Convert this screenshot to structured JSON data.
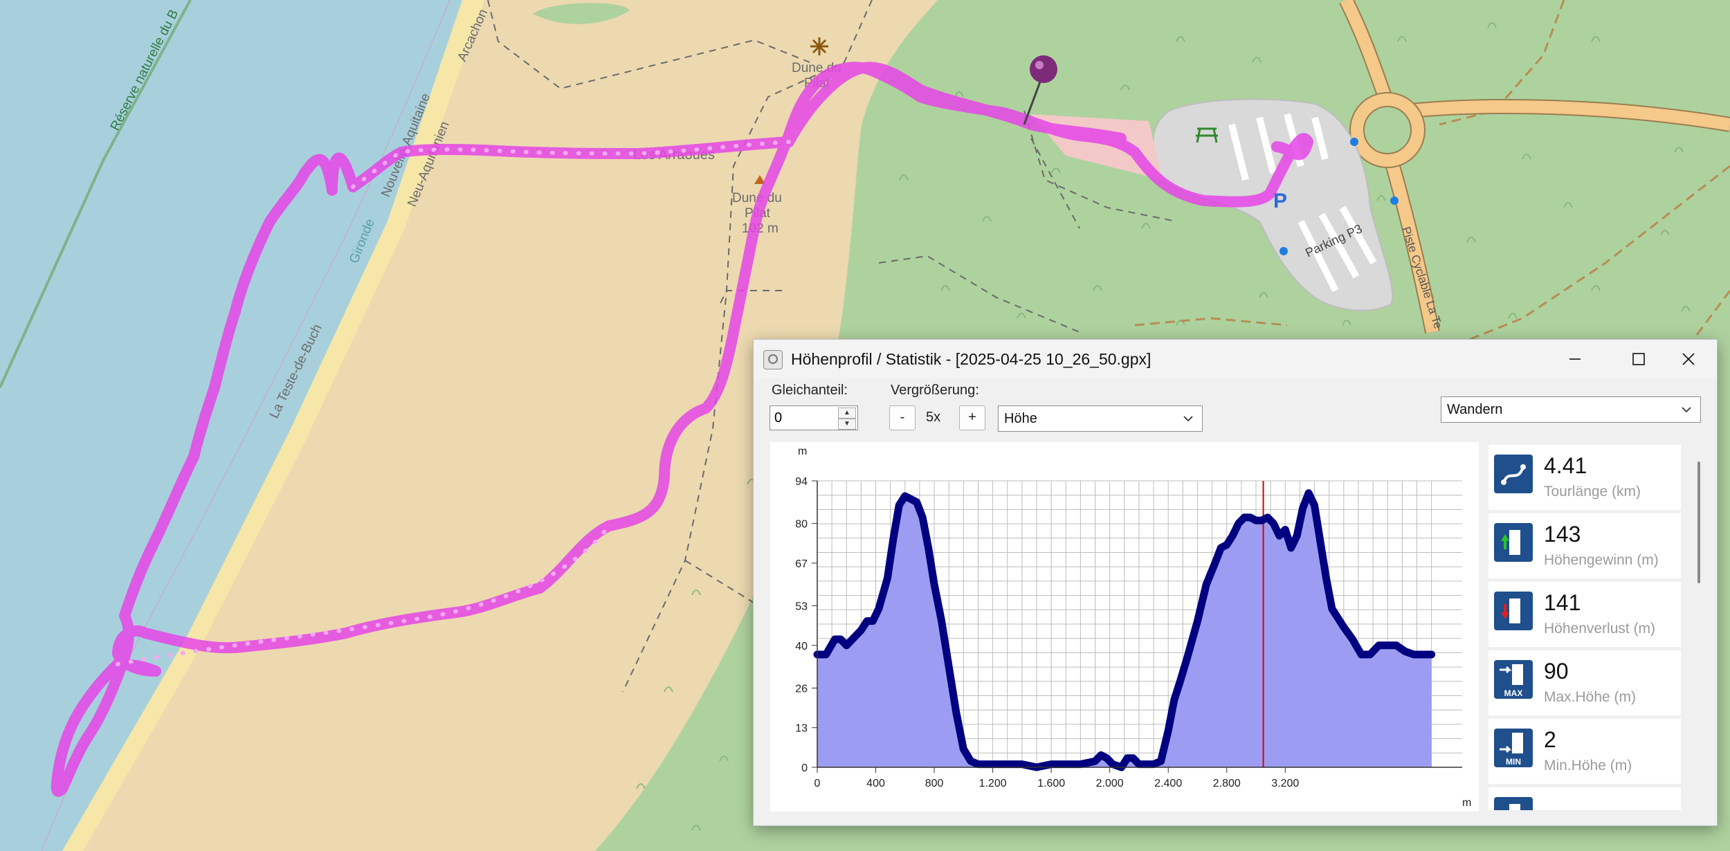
{
  "map": {
    "labels": {
      "reserve": "Réserve naturelle du B",
      "arcachon": "Arcachon",
      "nouvelle_aquitaine": "Nouvelle-Aquitaine",
      "neu_aquitanien": "Neu-Aquitanien",
      "gironde": "Gironde",
      "la_teste": "La Teste-de-Buch",
      "les_arraoues": "Les Arraoues",
      "dune_pilat_1": "Dune du",
      "dune_pilat_1b": "Pilat",
      "dune_pilat_2": "Dune du",
      "dune_pilat_2b": "Pilat",
      "dune_height": "102 m",
      "parking": "Parking P3",
      "piste": "Piste Cyclable La Te",
      "parking_symbol": "P"
    },
    "colors": {
      "sea": "#a8d0dc",
      "sand": "#ecd9b0",
      "forest": "#aed29e",
      "track": "#e545e6"
    }
  },
  "window": {
    "title": "Höhenprofil / Statistik - [2025-04-25 10_26_50.gpx]",
    "minimize_icon": "minimize-icon",
    "maximize_icon": "maximize-icon",
    "close_icon": "close-icon"
  },
  "controls": {
    "gleichanteil_label": "Gleichanteil:",
    "gleichanteil_value": "0",
    "zoom_label": "Vergrößerung:",
    "zoom_minus": "-",
    "zoom_value": "5x",
    "zoom_plus": "+",
    "profile_select": "Höhe",
    "activity_select": "Wandern"
  },
  "chart_data": {
    "type": "area",
    "title": "",
    "xlabel": "m",
    "ylabel": "m",
    "x_ticks": [
      "0",
      "400",
      "800",
      "1.200",
      "1.600",
      "2.000",
      "2.400",
      "2.800",
      "3.200"
    ],
    "y_ticks": [
      "94",
      "80",
      "67",
      "53",
      "40",
      "26",
      "13",
      "0"
    ],
    "xlim": [
      0,
      4410
    ],
    "ylim": [
      0,
      94
    ],
    "grid": true,
    "cursor_x": 3050,
    "line_color": "#000080",
    "fill_color": "#9c9cf2",
    "cursor_color": "#d80000",
    "series": [
      {
        "x": [
          0,
          60,
          120,
          160,
          200,
          240,
          300,
          340,
          380,
          420,
          480,
          520,
          560,
          600,
          640,
          680,
          720,
          760,
          800,
          850,
          900,
          950,
          1000,
          1050,
          1100,
          1150,
          1200,
          1260,
          1300,
          1400,
          1500,
          1600,
          1700,
          1800,
          1900,
          1940,
          1980,
          2020,
          2080,
          2120,
          2160,
          2200,
          2240,
          2300,
          2350,
          2400,
          2440,
          2480,
          2530,
          2600,
          2660,
          2720,
          2760,
          2800,
          2840,
          2880,
          2920,
          2960,
          3000,
          3040,
          3080,
          3120,
          3160,
          3200,
          3240,
          3280,
          3320,
          3360,
          3400,
          3440,
          3480,
          3520,
          3560,
          3600,
          3660,
          3720,
          3780,
          3840,
          3900,
          3960,
          4020,
          4080,
          4140,
          4200
        ],
        "values": [
          37,
          37,
          42,
          42,
          40,
          42,
          45,
          48,
          48,
          52,
          62,
          75,
          86,
          89,
          88,
          87,
          82,
          72,
          60,
          48,
          33,
          18,
          6,
          2,
          1,
          1,
          1,
          1,
          1,
          1,
          0,
          1,
          1,
          1,
          2,
          4,
          3,
          1,
          0,
          3,
          3,
          1,
          1,
          1,
          2,
          12,
          22,
          28,
          36,
          48,
          60,
          67,
          72,
          73,
          76,
          80,
          82,
          82,
          81,
          81,
          82,
          80,
          76,
          78,
          72,
          76,
          85,
          90,
          86,
          74,
          62,
          52,
          49,
          46,
          42,
          37,
          37,
          40,
          40,
          40,
          38,
          37,
          37,
          37
        ]
      }
    ]
  },
  "stats": [
    {
      "value": "4.41",
      "caption": "Tourlänge (km)",
      "icon": "tour-length-icon"
    },
    {
      "value": "143",
      "caption": "Höhengewinn (m)",
      "icon": "elevation-gain-icon"
    },
    {
      "value": "141",
      "caption": "Höhenverlust (m)",
      "icon": "elevation-loss-icon"
    },
    {
      "value": "90",
      "caption": "Max.Höhe (m)",
      "icon": "max-height-icon",
      "badge": "MAX"
    },
    {
      "value": "2",
      "caption": "Min.Höhe (m)",
      "icon": "min-height-icon",
      "badge": "MIN"
    },
    {
      "value": "",
      "caption": "",
      "icon": "duration-icon"
    }
  ]
}
